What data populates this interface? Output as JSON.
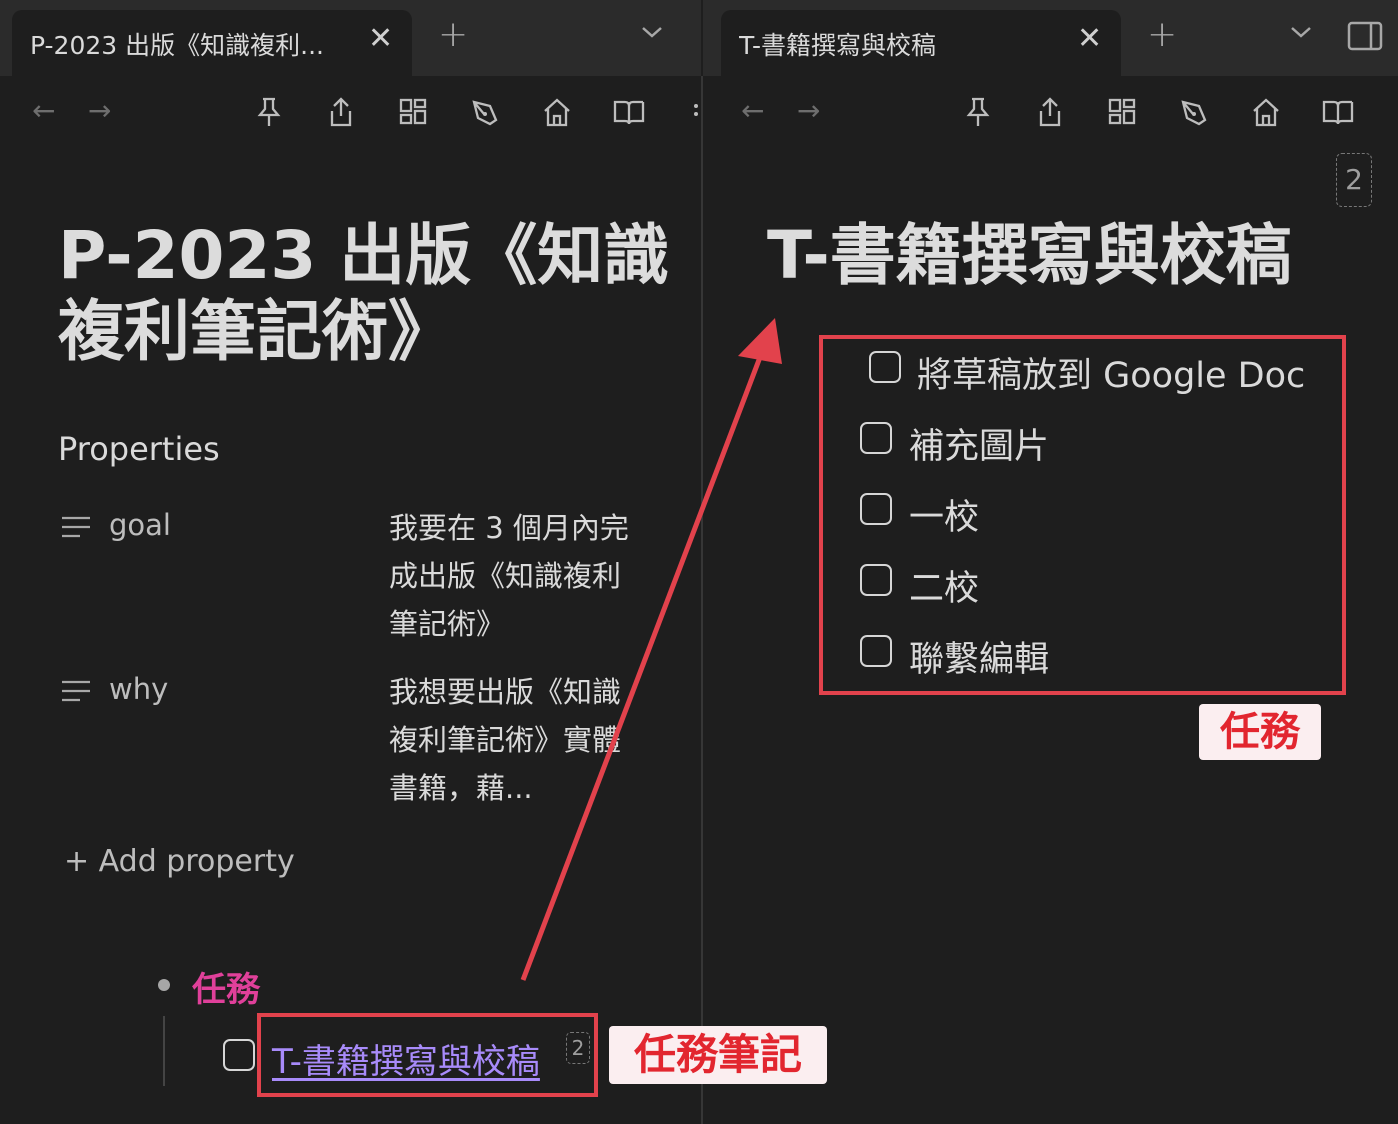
{
  "left_pane": {
    "tab_title": "P-2023 出版《知識複利...",
    "doc_title": "P-2023 出版《知識複利筆記術》",
    "properties_heading": "Properties",
    "properties": [
      {
        "key": "goal",
        "value": "我要在 3 個月內完成出版《知識複利筆記術》"
      },
      {
        "key": "why",
        "value": "我想要出版《知識複利筆記術》實體書籍，藉..."
      }
    ],
    "add_property": "+ Add property",
    "task_heading": "任務",
    "task_link": "T-書籍撰寫與校稿",
    "task_link_count": "2"
  },
  "right_pane": {
    "tab_title": "T-書籍撰寫與校稿",
    "doc_title": "T-書籍撰寫與校稿",
    "backlink_count": "2",
    "todos": [
      "將草稿放到 Google Doc",
      "補充圖片",
      "一校",
      "二校",
      "聯繫編輯"
    ]
  },
  "annotations": {
    "tasks_label": "任務",
    "task_note_label": "任務筆記",
    "color": "#e2424c"
  },
  "colors": {
    "background": "#1e1e1e",
    "tab_bar": "#2b2b2b",
    "task_heading": "#e0409a",
    "link": "#a88bfa"
  }
}
